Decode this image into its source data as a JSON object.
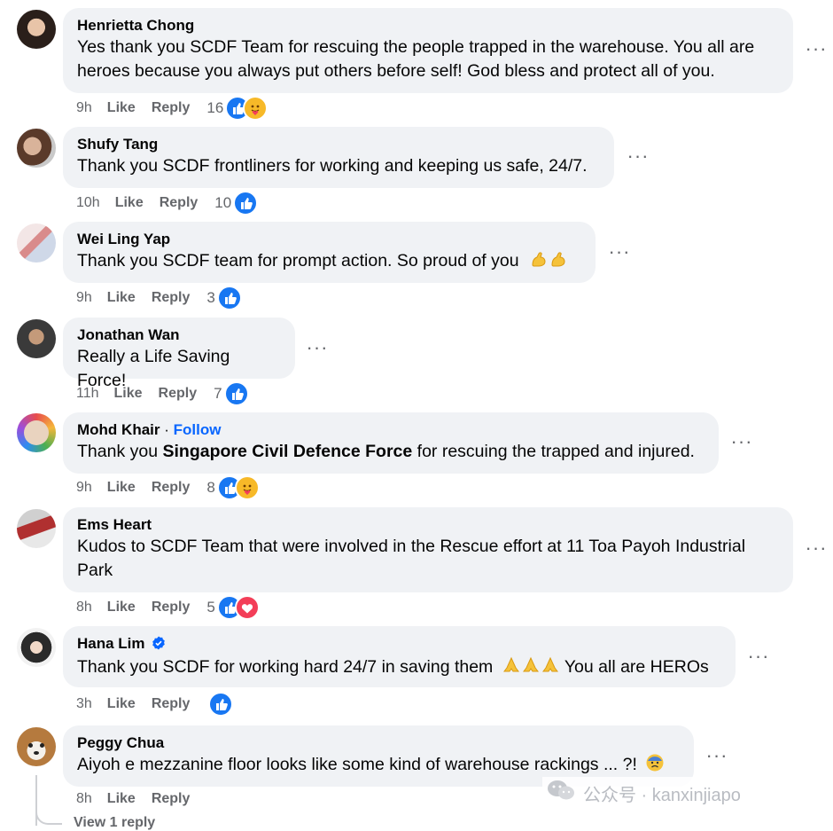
{
  "comments": [
    {
      "author": "Henrietta Chong",
      "text": "Yes thank you SCDF Team for rescuing the people trapped in the warehouse. You all are heroes because you always put others before self! God bless and protect all of you.",
      "time": "9h",
      "like": "Like",
      "reply": "Reply",
      "count": "16",
      "reactions": [
        "like",
        "care"
      ]
    },
    {
      "author": "Shufy Tang",
      "text": "Thank you SCDF frontliners for working and keeping us safe, 24/7.",
      "time": "10h",
      "like": "Like",
      "reply": "Reply",
      "count": "10",
      "reactions": [
        "like"
      ]
    },
    {
      "author": "Wei Ling Yap",
      "text": "Thank you SCDF team for prompt action. So proud of you",
      "time": "9h",
      "like": "Like",
      "reply": "Reply",
      "count": "3",
      "reactions": [
        "like"
      ],
      "emoji_names": [
        "flexed-biceps",
        "flexed-biceps"
      ]
    },
    {
      "author": "Jonathan Wan",
      "text": "Really a Life Saving Force!",
      "time": "11h",
      "like": "Like",
      "reply": "Reply",
      "count": "7",
      "reactions": [
        "like"
      ]
    },
    {
      "author": "Mohd Khair",
      "follow_separator": "·",
      "follow": "Follow",
      "text_before": "Thank you",
      "mention": "Singapore Civil Defence Force",
      "text_after": "for rescuing the trapped and injured.",
      "time": "9h",
      "like": "Like",
      "reply": "Reply",
      "count": "8",
      "reactions": [
        "like",
        "care"
      ]
    },
    {
      "author": "Ems Heart",
      "text": "Kudos to SCDF Team that were involved in the Rescue effort at 11 Toa Payoh Industrial Park",
      "time": "8h",
      "like": "Like",
      "reply": "Reply",
      "count": "5",
      "reactions": [
        "like",
        "love"
      ]
    },
    {
      "author": "Hana Lim",
      "verified": true,
      "text_before": "Thank you SCDF for working hard 24/7 in saving them",
      "text_after": "You all are HEROs",
      "emoji_names": [
        "folded-hands",
        "folded-hands",
        "folded-hands"
      ],
      "time": "3h",
      "like": "Like",
      "reply": "Reply",
      "count": "",
      "reactions": [
        "like"
      ]
    },
    {
      "author": "Peggy Chua",
      "text": "Aiyoh e mezzanine floor looks like some kind of warehouse rackings ... ?!",
      "emoji_names": [
        "anxious-face"
      ],
      "time": "8h",
      "like": "Like",
      "reply": "Reply"
    }
  ],
  "view_replies": "View 1 reply",
  "watermark": {
    "label": "公众号 · kanxinjiapo",
    "icon": "wechat-icon"
  },
  "colors": {
    "bubble": "#f0f2f5",
    "meta": "#65676b",
    "like_blue": "#1877f2",
    "care_yellow": "#f7b928",
    "love_red": "#f33e58",
    "follow_blue": "#0866ff"
  }
}
